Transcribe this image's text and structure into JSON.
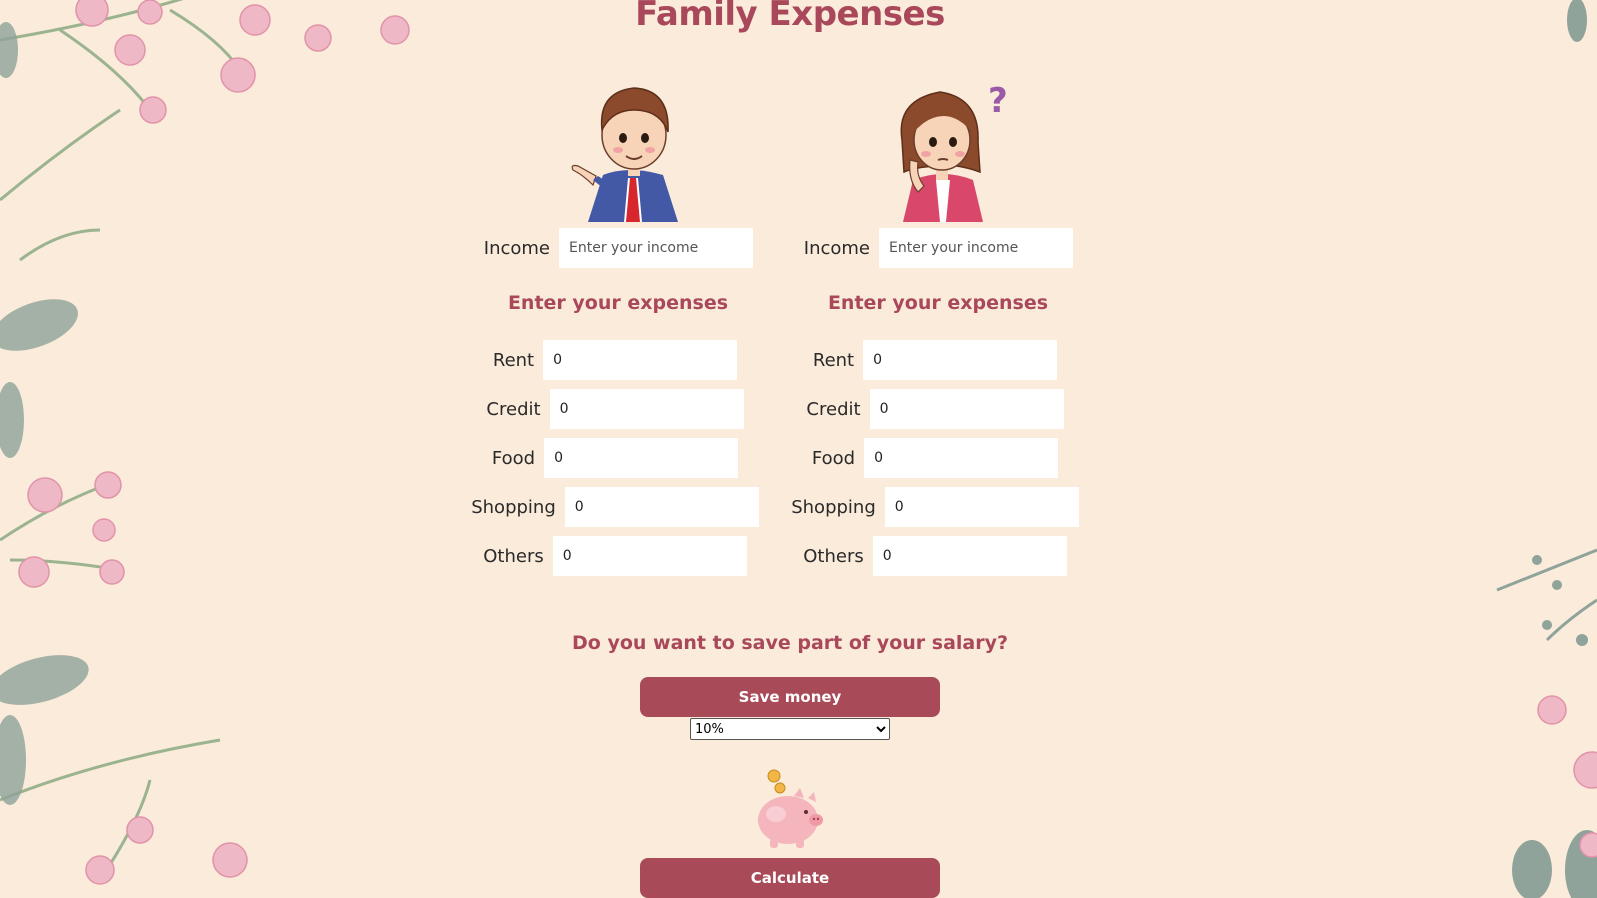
{
  "title": "Family Expenses",
  "person1": {
    "income_label": "Income",
    "income_placeholder": "Enter your income",
    "expenses_heading": "Enter your expenses",
    "expenses": [
      {
        "label": "Rent",
        "value": "0"
      },
      {
        "label": "Credit",
        "value": "0"
      },
      {
        "label": "Food",
        "value": "0"
      },
      {
        "label": "Shopping",
        "value": "0"
      },
      {
        "label": "Others",
        "value": "0"
      }
    ]
  },
  "person2": {
    "income_label": "Income",
    "income_placeholder": "Enter your income",
    "expenses_heading": "Enter your expenses",
    "expenses": [
      {
        "label": "Rent",
        "value": "0"
      },
      {
        "label": "Credit",
        "value": "0"
      },
      {
        "label": "Food",
        "value": "0"
      },
      {
        "label": "Shopping",
        "value": "0"
      },
      {
        "label": "Others",
        "value": "0"
      }
    ]
  },
  "save": {
    "question": "Do you want to save part of your salary?",
    "button_label": "Save money",
    "selected_percent": "10%"
  },
  "calculate_label": "Calculate",
  "colors": {
    "background": "#faebda",
    "accent": "#a94a58",
    "heading": "#a9485a"
  },
  "icons": {
    "man": "man-avatar-icon",
    "woman": "woman-thinking-avatar-icon",
    "piggy": "piggy-bank-icon"
  }
}
